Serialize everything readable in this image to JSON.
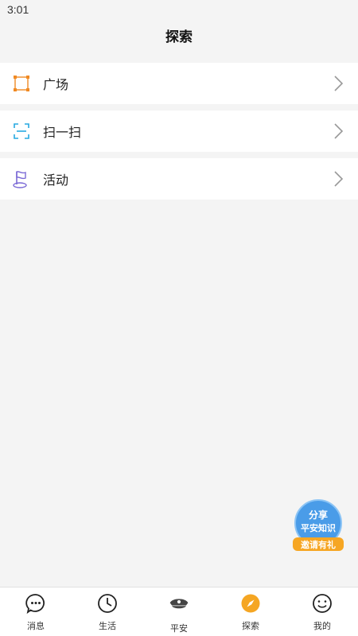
{
  "status_bar": {
    "time": "3:01"
  },
  "header": {
    "title": "探索"
  },
  "menu": {
    "items": [
      {
        "label": "广场",
        "icon": "plaza-frame-icon"
      },
      {
        "label": "扫一扫",
        "icon": "scan-icon"
      },
      {
        "label": "活动",
        "icon": "flag-icon"
      }
    ]
  },
  "promo": {
    "line1": "分享",
    "line2": "平安知识",
    "line3": "邀请有礼"
  },
  "tabs": [
    {
      "label": "消息",
      "icon": "chat-bubble-icon"
    },
    {
      "label": "生活",
      "icon": "clock-icon"
    },
    {
      "label": "平安",
      "icon": "police-cap-icon"
    },
    {
      "label": "探索",
      "icon": "compass-icon",
      "active": true
    },
    {
      "label": "我的",
      "icon": "smiley-icon"
    }
  ],
  "colors": {
    "accent": "#f5a623",
    "plaza": "#f08a24",
    "scan": "#27a9e1",
    "flag": "#7b6ad6",
    "badge_blue": "#4a9ce8",
    "badge_yellow": "#f6a623"
  }
}
